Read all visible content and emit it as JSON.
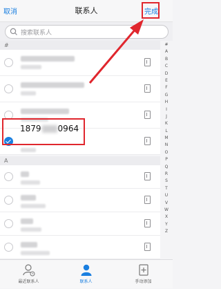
{
  "header": {
    "cancel_label": "取消",
    "title": "联系人",
    "done_label": "完成"
  },
  "search": {
    "placeholder": "搜索联系人"
  },
  "sections": [
    {
      "letter": "#"
    },
    {
      "letter": "A"
    }
  ],
  "selected_contact": {
    "phone_prefix": "1879",
    "phone_suffix": "0964"
  },
  "index_letters": [
    "#",
    "A",
    "B",
    "C",
    "D",
    "E",
    "F",
    "G",
    "H",
    "I",
    "J",
    "K",
    "L",
    "M",
    "N",
    "O",
    "P",
    "Q",
    "R",
    "S",
    "T",
    "U",
    "V",
    "W",
    "X",
    "Y",
    "Z"
  ],
  "tabs": [
    {
      "label": "最近联系人",
      "icon": "recent-contacts-icon"
    },
    {
      "label": "联系人",
      "icon": "contacts-icon"
    },
    {
      "label": "手动添加",
      "icon": "manual-add-icon"
    }
  ],
  "colors": {
    "accent": "#1a7fe0",
    "highlight_red": "#e0262d"
  }
}
